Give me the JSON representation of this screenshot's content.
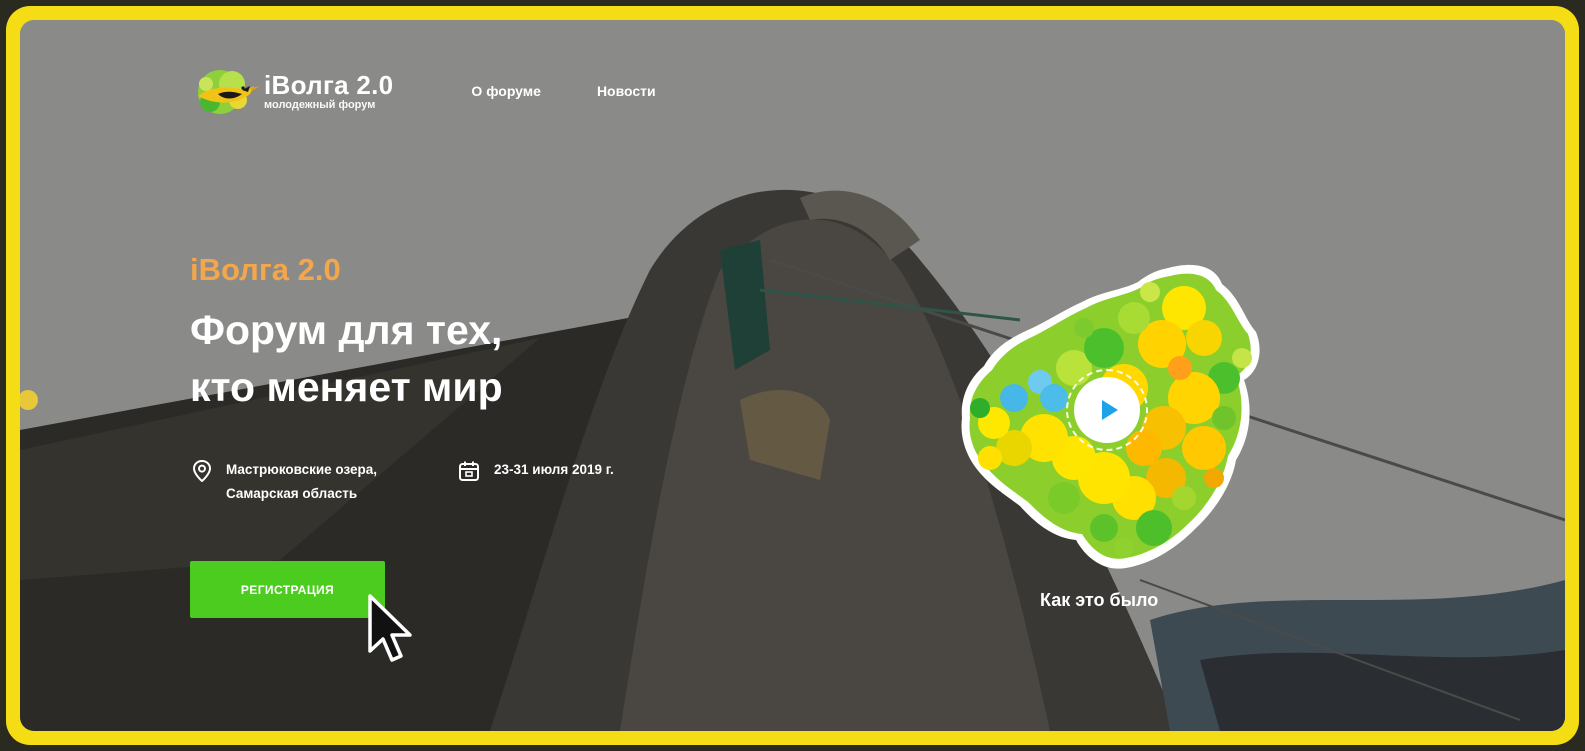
{
  "header": {
    "logo_title": "iВолга 2.0",
    "logo_subtitle": "молодежный форум",
    "nav": [
      "О форуме",
      "Новости"
    ]
  },
  "hero": {
    "kicker": "iВолга 2.0",
    "title_line1": "Форум для тех,",
    "title_line2": "кто меняет мир",
    "location_line1": "Мастрюковские озера,",
    "location_line2": "Самарская область",
    "dates": "23-31 июля 2019 г.",
    "register_label": "РЕГИСТРАЦИЯ"
  },
  "video": {
    "caption": "Как это было"
  },
  "icons": {
    "location": "map-pin-icon",
    "calendar": "calendar-icon",
    "play": "play-icon",
    "cursor": "mouse-pointer-icon",
    "logo": "oriole-bird-icon"
  },
  "colors": {
    "frame": "#f5dd16",
    "accent_orange": "#f3a64b",
    "button_green": "#4ccc1f",
    "play_blue": "#1ea2e8"
  }
}
